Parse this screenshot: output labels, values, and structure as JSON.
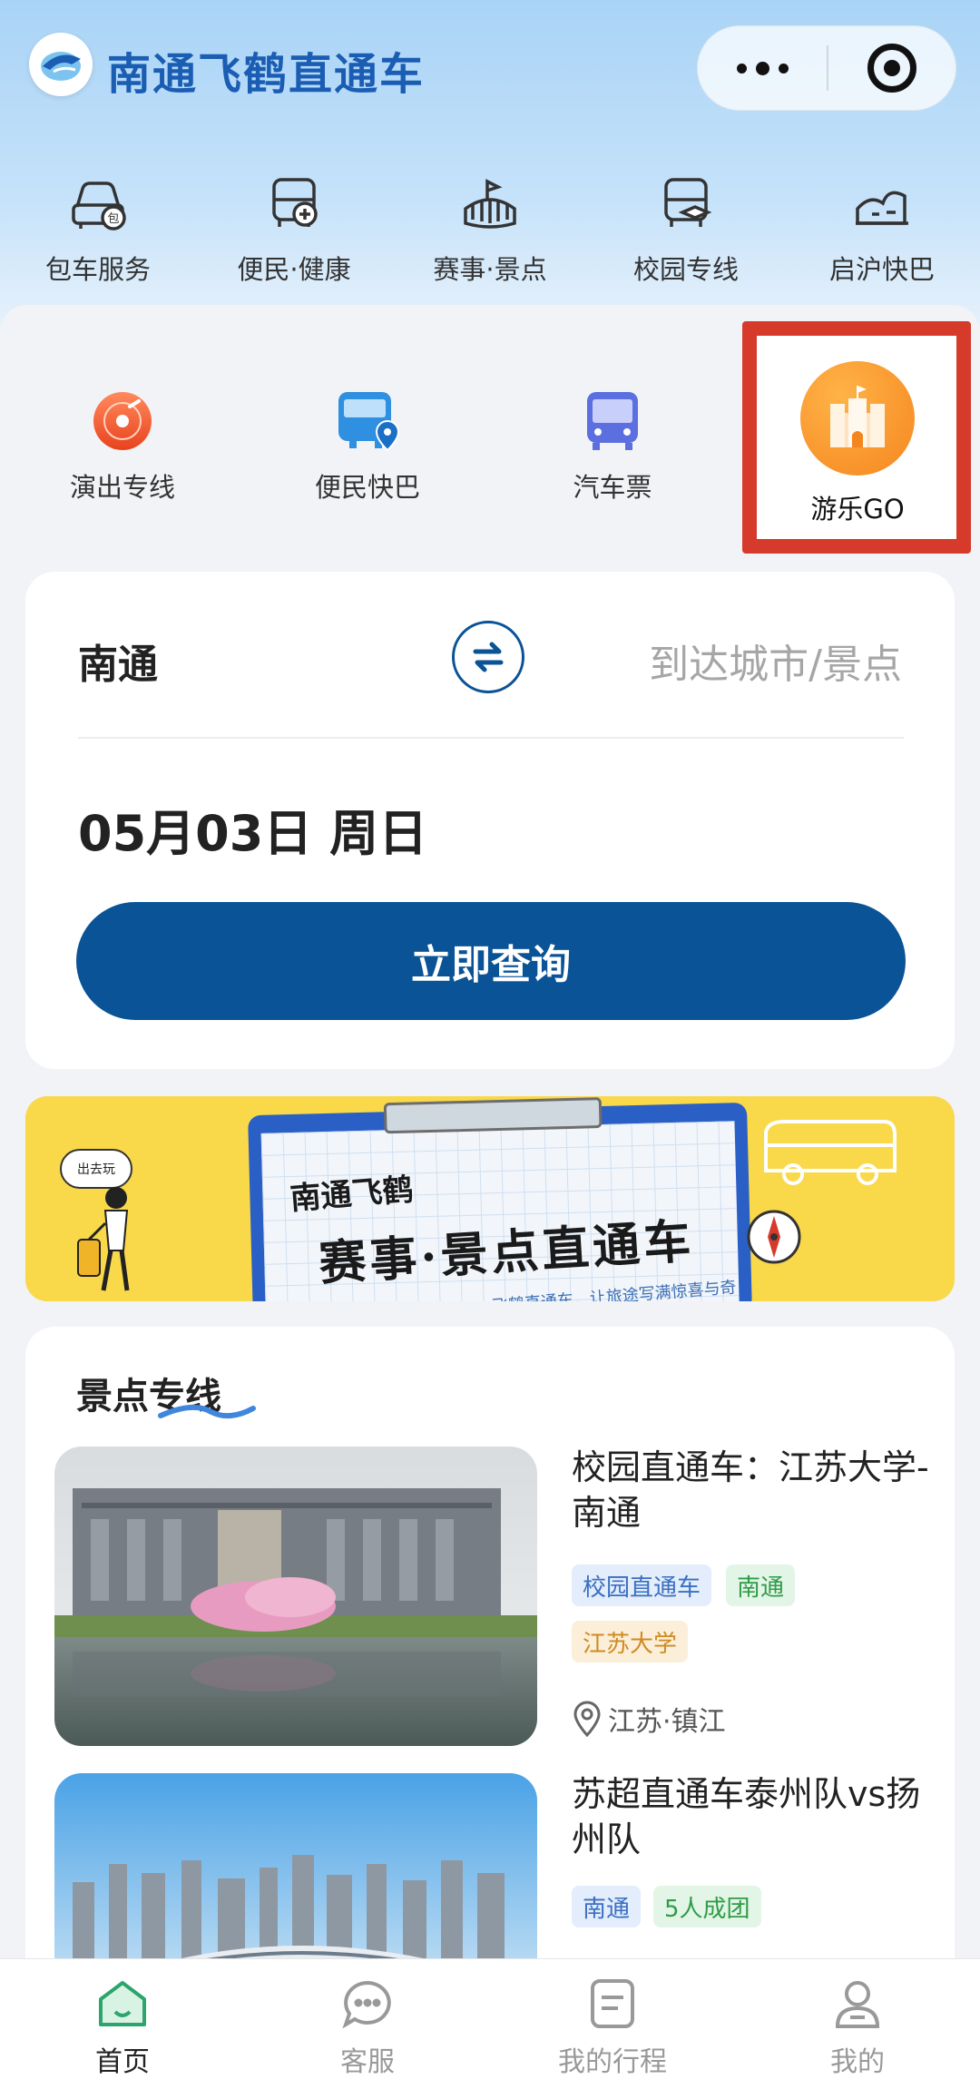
{
  "header": {
    "app_title": "南通飞鹤直通车"
  },
  "categories": [
    {
      "label": "包车服务",
      "icon": "car-icon"
    },
    {
      "label": "便民·健康",
      "icon": "health-bus-icon"
    },
    {
      "label": "赛事·景点",
      "icon": "stadium-icon"
    },
    {
      "label": "校园专线",
      "icon": "campus-bus-icon"
    },
    {
      "label": "启沪快巴",
      "icon": "landmark-icon"
    }
  ],
  "features": [
    {
      "label": "演出专线",
      "icon": "vinyl-record-icon"
    },
    {
      "label": "便民快巴",
      "icon": "bus-location-icon"
    },
    {
      "label": "汽车票",
      "icon": "bus-ticket-icon"
    },
    {
      "label": "游乐GO",
      "icon": "castle-icon"
    }
  ],
  "search": {
    "from": "南通",
    "to_placeholder": "到达城市/景点",
    "date": "05月03日 周日",
    "button": "立即查询"
  },
  "banner": {
    "brand": "南通飞鹤",
    "title": "赛事·景点直通车",
    "tagline": "飞鹤直通车，让旅途写满惊喜与奇遇",
    "bubble": "出去玩"
  },
  "section": {
    "title": "景点专线",
    "items": [
      {
        "title": "校园直通车：江苏大学-南通",
        "tags": [
          "校园直通车",
          "南通",
          "江苏大学"
        ],
        "location": "江苏·镇江"
      },
      {
        "title": "苏超直通车泰州队vs扬州队",
        "tags": [
          "南通",
          "5人成团"
        ]
      }
    ]
  },
  "tabbar": [
    {
      "label": "首页",
      "icon": "home-icon",
      "active": true
    },
    {
      "label": "客服",
      "icon": "chat-icon",
      "active": false
    },
    {
      "label": "我的行程",
      "icon": "itinerary-icon",
      "active": false
    },
    {
      "label": "我的",
      "icon": "profile-icon",
      "active": false
    }
  ],
  "colors": {
    "brand_blue": "#0a5396",
    "title_blue": "#1a5db3",
    "highlight_red": "#d63a2b",
    "active_tab_green": "#2ba56b"
  }
}
